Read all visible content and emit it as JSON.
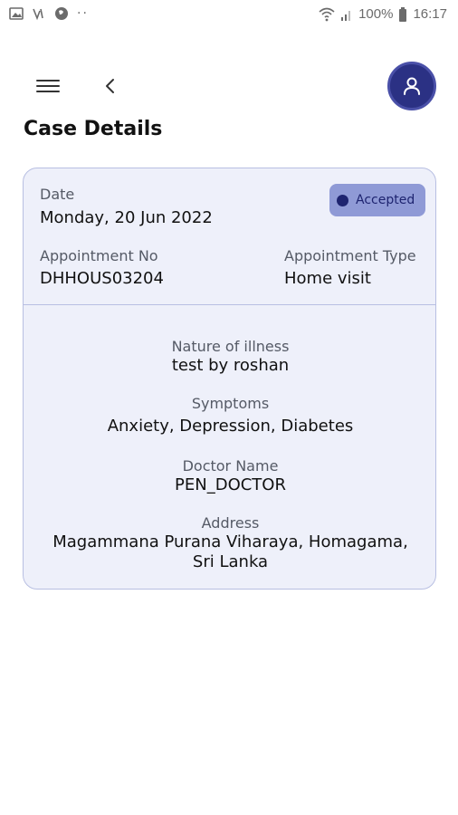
{
  "status_bar": {
    "battery": "100%",
    "time": "16:17",
    "dots": "··"
  },
  "header": {
    "menu_icon": "hamburger-menu-icon",
    "back_icon": "chevron-left-icon",
    "profile_icon": "user-icon",
    "accent_color": "#2b3184"
  },
  "page": {
    "title": "Case Details"
  },
  "case": {
    "date_label": "Date",
    "date_value": "Monday, 20 Jun 2022",
    "status": "Accepted",
    "status_color": "#8f9ad6",
    "appointment_no_label": "Appointment No",
    "appointment_no_value": "DHHOUS03204",
    "appointment_type_label": "Appointment Type",
    "appointment_type_value": "Home visit",
    "illness_label": "Nature of illness",
    "illness_value": "test by roshan",
    "symptoms_label": "Symptoms",
    "symptoms_value": "Anxiety, Depression, Diabetes",
    "doctor_label": "Doctor Name",
    "doctor_value": "PEN_DOCTOR",
    "address_label": "Address",
    "address_line1": "Magammana Purana Viharaya, Homagama,",
    "address_line2": "Sri Lanka"
  }
}
